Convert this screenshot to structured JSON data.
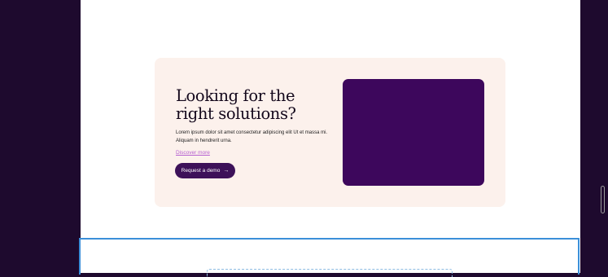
{
  "hero": {
    "title": "Looking for the right solutions?",
    "description": "Lorem ipsum dolor sit amet consectetur adipiscing elit Ut et massa mi. Aliquam in hendrerit urna.",
    "link_label": "Discover more",
    "cta_label": "Request a demo",
    "cta_icon": "arrow-right-icon"
  },
  "colors": {
    "app_background": "#1e0a2e",
    "card_background": "#fcf1ec",
    "brand_purple": "#3d075c",
    "link": "#b55fd1",
    "selection_outline": "#3b8fd9"
  }
}
